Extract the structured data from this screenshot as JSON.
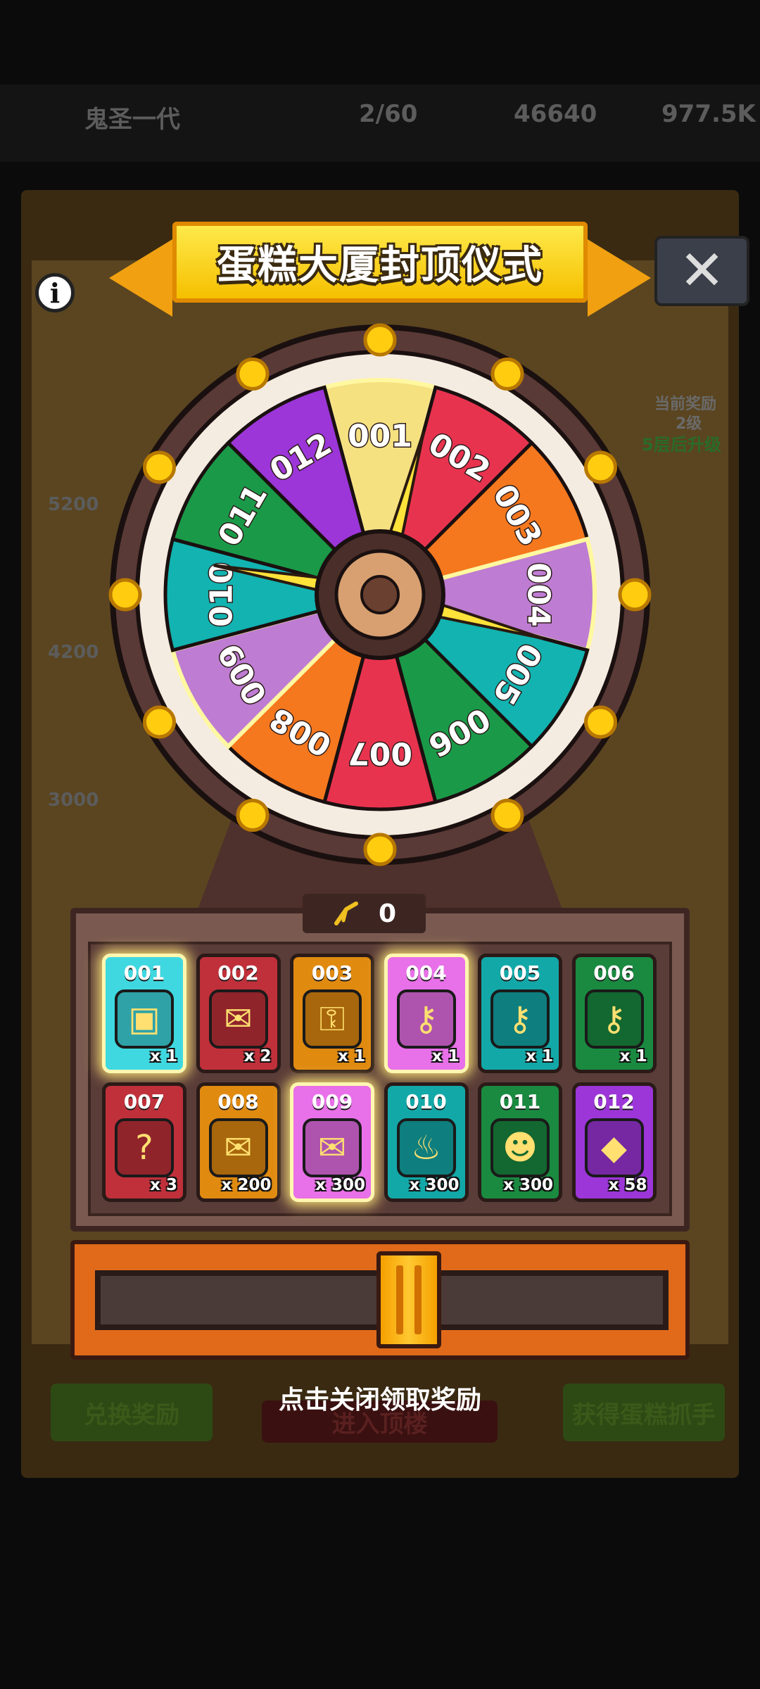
{
  "background": {
    "player_name": "鬼圣一代",
    "energy": "2/60",
    "currency_a": "46640",
    "currency_b": "977.5K",
    "current_reward_label": "当前奖励",
    "current_reward_level": "2级",
    "upgrade_hint": "5层后升级",
    "milestones": [
      "5200",
      "4200",
      "3000"
    ],
    "btn_exchange": "兑换奖励",
    "btn_enter": "进入顶楼",
    "btn_get": "获得蛋糕抓手"
  },
  "header": {
    "title": "蛋糕大厦封顶仪式"
  },
  "close_label": "✕",
  "info_label": "i",
  "wheel": {
    "segments": [
      {
        "label": "001",
        "color": "#f2d25a",
        "highlight": true
      },
      {
        "label": "002",
        "color": "#e8334f"
      },
      {
        "label": "003",
        "color": "#f5781e"
      },
      {
        "label": "004",
        "color": "#9c36d8",
        "highlight": true
      },
      {
        "label": "005",
        "color": "#12b3b0"
      },
      {
        "label": "006",
        "color": "#1a9a48"
      },
      {
        "label": "007",
        "color": "#e8334f"
      },
      {
        "label": "008",
        "color": "#f5781e"
      },
      {
        "label": "009",
        "color": "#9c36d8",
        "highlight": true
      },
      {
        "label": "010",
        "color": "#12b3b0"
      },
      {
        "label": "011",
        "color": "#1a9a48"
      },
      {
        "label": "012",
        "color": "#9c36d8"
      }
    ]
  },
  "counter": {
    "value": "0"
  },
  "prizes": [
    {
      "id": "001",
      "qty": "x 1",
      "color": "#3fd8e0",
      "icon": "mystery-chest-icon",
      "glyph": "▣",
      "glow": true
    },
    {
      "id": "002",
      "qty": "x 2",
      "color": "#c0303a",
      "icon": "letter-icon",
      "glyph": "✉"
    },
    {
      "id": "003",
      "qty": "x 1",
      "color": "#e08a10",
      "icon": "silver-key-icon",
      "glyph": "⚿"
    },
    {
      "id": "004",
      "qty": "x 1",
      "color": "#e870e8",
      "icon": "gold-key-icon",
      "glyph": "⚷",
      "glow": true
    },
    {
      "id": "005",
      "qty": "x 1",
      "color": "#13a8a8",
      "icon": "purple-key-icon",
      "glyph": "⚷"
    },
    {
      "id": "006",
      "qty": "x 1",
      "color": "#1a8a40",
      "icon": "purple-key-icon",
      "glyph": "⚷"
    },
    {
      "id": "007",
      "qty": "x 3",
      "color": "#c0303a",
      "icon": "mystery-box-icon",
      "glyph": "?"
    },
    {
      "id": "008",
      "qty": "x 200",
      "color": "#e08a10",
      "icon": "heart-letter-icon",
      "glyph": "✉"
    },
    {
      "id": "009",
      "qty": "x 300",
      "color": "#e870e8",
      "icon": "heart-letter-icon",
      "glyph": "✉",
      "glow": true
    },
    {
      "id": "010",
      "qty": "x 300",
      "color": "#13a8a8",
      "icon": "flame-icon",
      "glyph": "♨"
    },
    {
      "id": "011",
      "qty": "x 300",
      "color": "#1a8a40",
      "icon": "lion-face-icon",
      "glyph": "☻"
    },
    {
      "id": "012",
      "qty": "x 58",
      "color": "#9c36d8",
      "icon": "green-gem-icon",
      "glyph": "◆"
    }
  ],
  "hint": "点击关闭领取奖励"
}
